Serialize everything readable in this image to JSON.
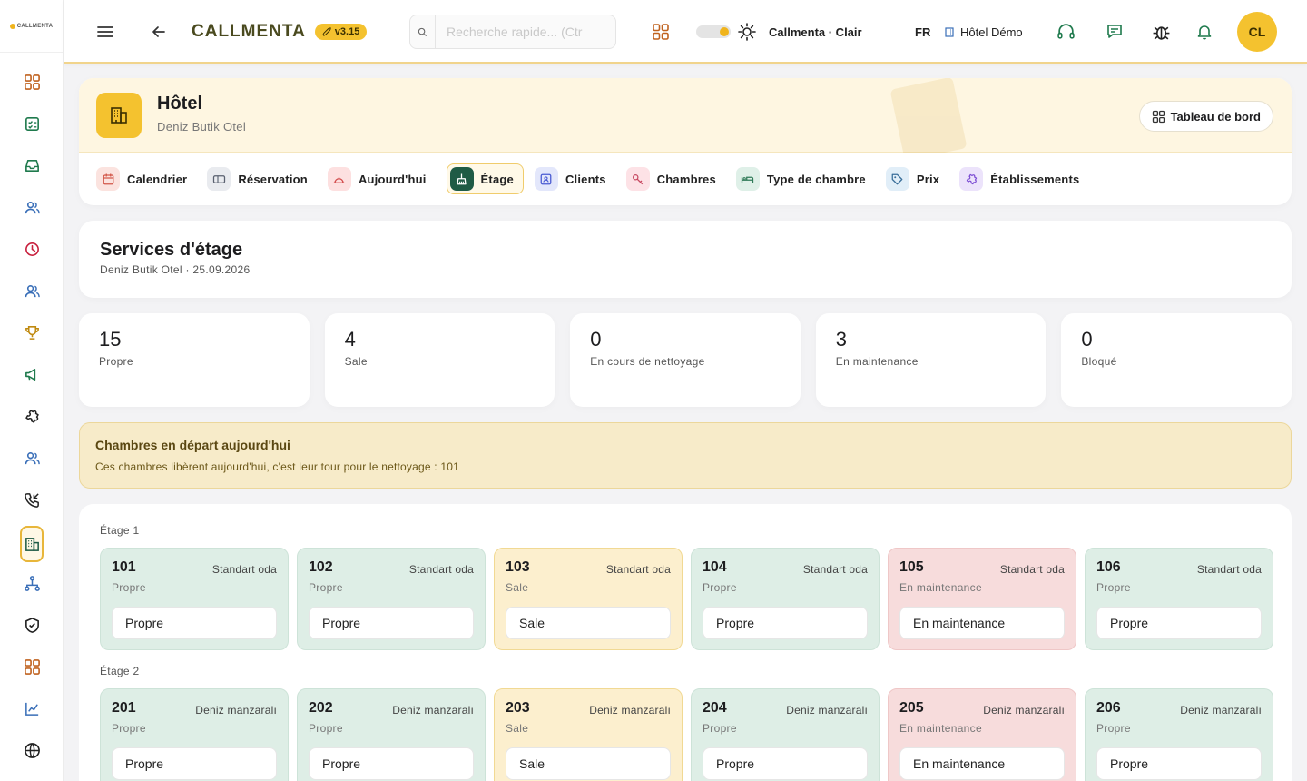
{
  "app": {
    "logo_text": "CALLMENTA",
    "brand": "CALLMENTA",
    "version": "v3.15",
    "search_placeholder": "Recherche rapide... (Ctr",
    "theme_label": "Callmenta · Clair",
    "language": "FR",
    "hotel_name": "Hôtel Démo",
    "avatar_initials": "CL",
    "accent_color": "#f4c22f"
  },
  "sidebar": {
    "icons": [
      "grid-icon",
      "checklist-icon",
      "inbox-icon",
      "users-icon",
      "clock-icon",
      "users-icon",
      "trophy-icon",
      "megaphone-icon",
      "puzzle-icon",
      "users-icon",
      "phone-incoming-icon",
      "hotel-building-icon",
      "network-icon",
      "shield-check-icon",
      "grid-icon",
      "chart-line-icon",
      "globe-icon"
    ],
    "active_index": 11
  },
  "hotel": {
    "title": "Hôtel",
    "subtitle": "Deniz Butik Otel",
    "dashboard_button": "Tableau de bord",
    "tabs": [
      {
        "label": "Calendrier",
        "icon": "calendar-icon",
        "bg": "#fbe3df",
        "fg": "#d2584a"
      },
      {
        "label": "Réservation",
        "icon": "card-icon",
        "bg": "#e9ebef",
        "fg": "#5a6170"
      },
      {
        "label": "Aujourd'hui",
        "icon": "bell-service-icon",
        "bg": "#fde0e0",
        "fg": "#d24a4a"
      },
      {
        "label": "Étage",
        "icon": "broom-icon",
        "bg": "#1f5b45",
        "fg": "#ffffff"
      },
      {
        "label": "Clients",
        "icon": "contact-icon",
        "bg": "#e3e7fb",
        "fg": "#4a5bd2"
      },
      {
        "label": "Chambres",
        "icon": "key-icon",
        "bg": "#fde2e6",
        "fg": "#c84a62"
      },
      {
        "label": "Type de chambre",
        "icon": "bed-icon",
        "bg": "#dff0e8",
        "fg": "#2f7a57"
      },
      {
        "label": "Prix",
        "icon": "tag-icon",
        "bg": "#e1eef8",
        "fg": "#3a6f9a"
      },
      {
        "label": "Établissements",
        "icon": "puzzle-icon",
        "bg": "#ece3fb",
        "fg": "#7a4ad2"
      }
    ],
    "active_tab": 3
  },
  "services": {
    "title": "Services d'étage",
    "subtitle": "Deniz Butik Otel · 25.09.2026"
  },
  "stats": [
    {
      "value": "15",
      "label": "Propre"
    },
    {
      "value": "4",
      "label": "Sale"
    },
    {
      "value": "0",
      "label": "En cours de nettoyage"
    },
    {
      "value": "3",
      "label": "En maintenance"
    },
    {
      "value": "0",
      "label": "Bloqué"
    }
  ],
  "alert": {
    "title": "Chambres en départ aujourd'hui",
    "text": "Ces chambres libèrent aujourd'hui, c'est leur tour pour le nettoyage : 101"
  },
  "floors": [
    {
      "label": "Étage 1",
      "rooms": [
        {
          "number": "101",
          "type": "Standart oda",
          "status": "Propre",
          "select": "Propre",
          "kind": "clean"
        },
        {
          "number": "102",
          "type": "Standart oda",
          "status": "Propre",
          "select": "Propre",
          "kind": "clean"
        },
        {
          "number": "103",
          "type": "Standart oda",
          "status": "Sale",
          "select": "Sale",
          "kind": "dirty"
        },
        {
          "number": "104",
          "type": "Standart oda",
          "status": "Propre",
          "select": "Propre",
          "kind": "clean"
        },
        {
          "number": "105",
          "type": "Standart oda",
          "status": "En maintenance",
          "select": "En maintenance",
          "kind": "maint"
        },
        {
          "number": "106",
          "type": "Standart oda",
          "status": "Propre",
          "select": "Propre",
          "kind": "clean"
        }
      ]
    },
    {
      "label": "Étage 2",
      "rooms": [
        {
          "number": "201",
          "type": "Deniz manzaralı",
          "status": "Propre",
          "select": "Propre",
          "kind": "clean"
        },
        {
          "number": "202",
          "type": "Deniz manzaralı",
          "status": "Propre",
          "select": "Propre",
          "kind": "clean"
        },
        {
          "number": "203",
          "type": "Deniz manzaralı",
          "status": "Sale",
          "select": "Sale",
          "kind": "dirty"
        },
        {
          "number": "204",
          "type": "Deniz manzaralı",
          "status": "Propre",
          "select": "Propre",
          "kind": "clean"
        },
        {
          "number": "205",
          "type": "Deniz manzaralı",
          "status": "En maintenance",
          "select": "En maintenance",
          "kind": "maint"
        },
        {
          "number": "206",
          "type": "Deniz manzaralı",
          "status": "Propre",
          "select": "Propre",
          "kind": "clean"
        }
      ]
    }
  ]
}
